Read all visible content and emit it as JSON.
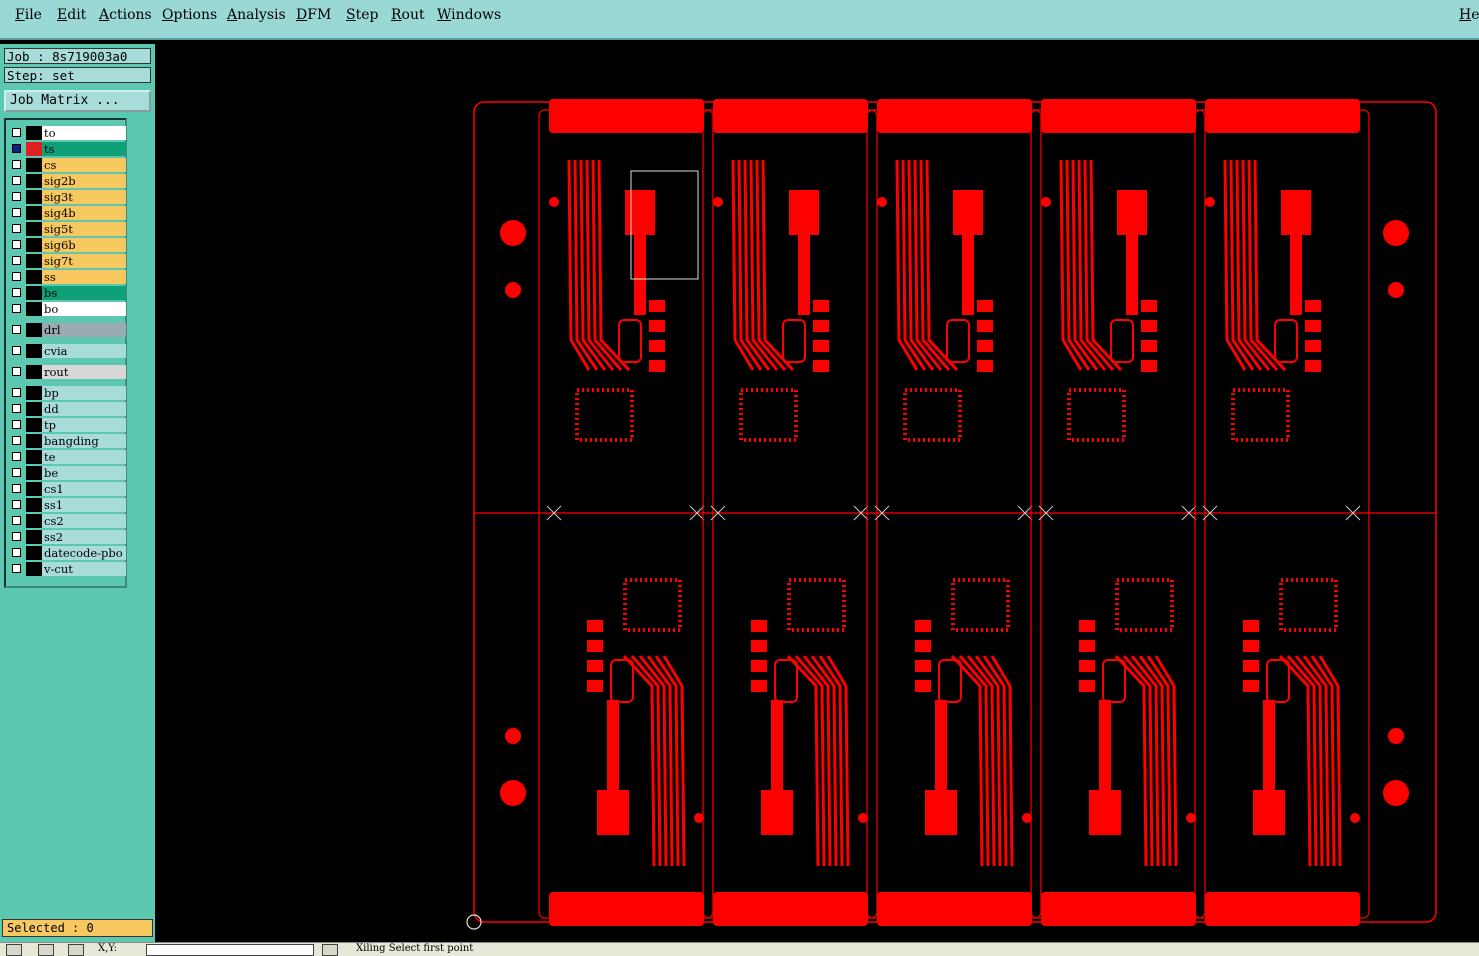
{
  "menubar": {
    "items": [
      "File",
      "Edit",
      "Actions",
      "Options",
      "Analysis",
      "DFM",
      "Step",
      "Rout",
      "Windows"
    ],
    "help": "Help"
  },
  "panel": {
    "job": "Job : 8s719003a0",
    "step": "Step: set",
    "job_matrix": "Job Matrix ...",
    "selected": "Selected : 0"
  },
  "layers": [
    {
      "name": "to",
      "bg": "#ffffff",
      "swatch": "#000000"
    },
    {
      "name": "ts",
      "bg": "#10a078",
      "swatch": "#e02020",
      "active": true
    },
    {
      "name": "cs",
      "bg": "#f8c860",
      "swatch": "#000000"
    },
    {
      "name": "sig2b",
      "bg": "#f8c860",
      "swatch": "#000000"
    },
    {
      "name": "sig3t",
      "bg": "#f8c860",
      "swatch": "#000000"
    },
    {
      "name": "sig4b",
      "bg": "#f8c860",
      "swatch": "#000000"
    },
    {
      "name": "sig5t",
      "bg": "#f8c860",
      "swatch": "#000000"
    },
    {
      "name": "sig6b",
      "bg": "#f8c860",
      "swatch": "#000000"
    },
    {
      "name": "sig7t",
      "bg": "#f8c860",
      "swatch": "#000000"
    },
    {
      "name": "ss",
      "bg": "#f8c860",
      "swatch": "#000000"
    },
    {
      "name": "bs",
      "bg": "#10a078",
      "swatch": "#000000"
    },
    {
      "name": "bo",
      "bg": "#ffffff",
      "swatch": "#000000"
    },
    {
      "name": "drl",
      "bg": "#9aaab0",
      "swatch": "#000000",
      "gap": true
    },
    {
      "name": "cvia",
      "bg": "#a8dcd8",
      "swatch": "#000000",
      "gap": true
    },
    {
      "name": "rout",
      "bg": "#d8d8d8",
      "swatch": "#000000",
      "gap": true
    },
    {
      "name": "bp",
      "bg": "#a8dcd8",
      "swatch": "#000000",
      "gap": true
    },
    {
      "name": "dd",
      "bg": "#a8dcd8",
      "swatch": "#000000"
    },
    {
      "name": "tp",
      "bg": "#a8dcd8",
      "swatch": "#000000"
    },
    {
      "name": "bangding",
      "bg": "#a8dcd8",
      "swatch": "#000000"
    },
    {
      "name": "te",
      "bg": "#a8dcd8",
      "swatch": "#000000"
    },
    {
      "name": "be",
      "bg": "#a8dcd8",
      "swatch": "#000000"
    },
    {
      "name": "cs1",
      "bg": "#a8dcd8",
      "swatch": "#000000"
    },
    {
      "name": "ss1",
      "bg": "#a8dcd8",
      "swatch": "#000000"
    },
    {
      "name": "cs2",
      "bg": "#a8dcd8",
      "swatch": "#000000"
    },
    {
      "name": "ss2",
      "bg": "#a8dcd8",
      "swatch": "#000000"
    },
    {
      "name": "datecode-pbo",
      "bg": "#a8dcd8",
      "swatch": "#000000"
    },
    {
      "name": "v-cut",
      "bg": "#a8dcd8",
      "swatch": "#000000"
    }
  ],
  "statusbar": {
    "coord_label": "X,Y:",
    "message": "Xiling Select first point"
  },
  "colors": {
    "trace": "#ff0000",
    "background": "#000000",
    "menubar": "#9ad8d6",
    "panel": "#5cc8b0"
  }
}
